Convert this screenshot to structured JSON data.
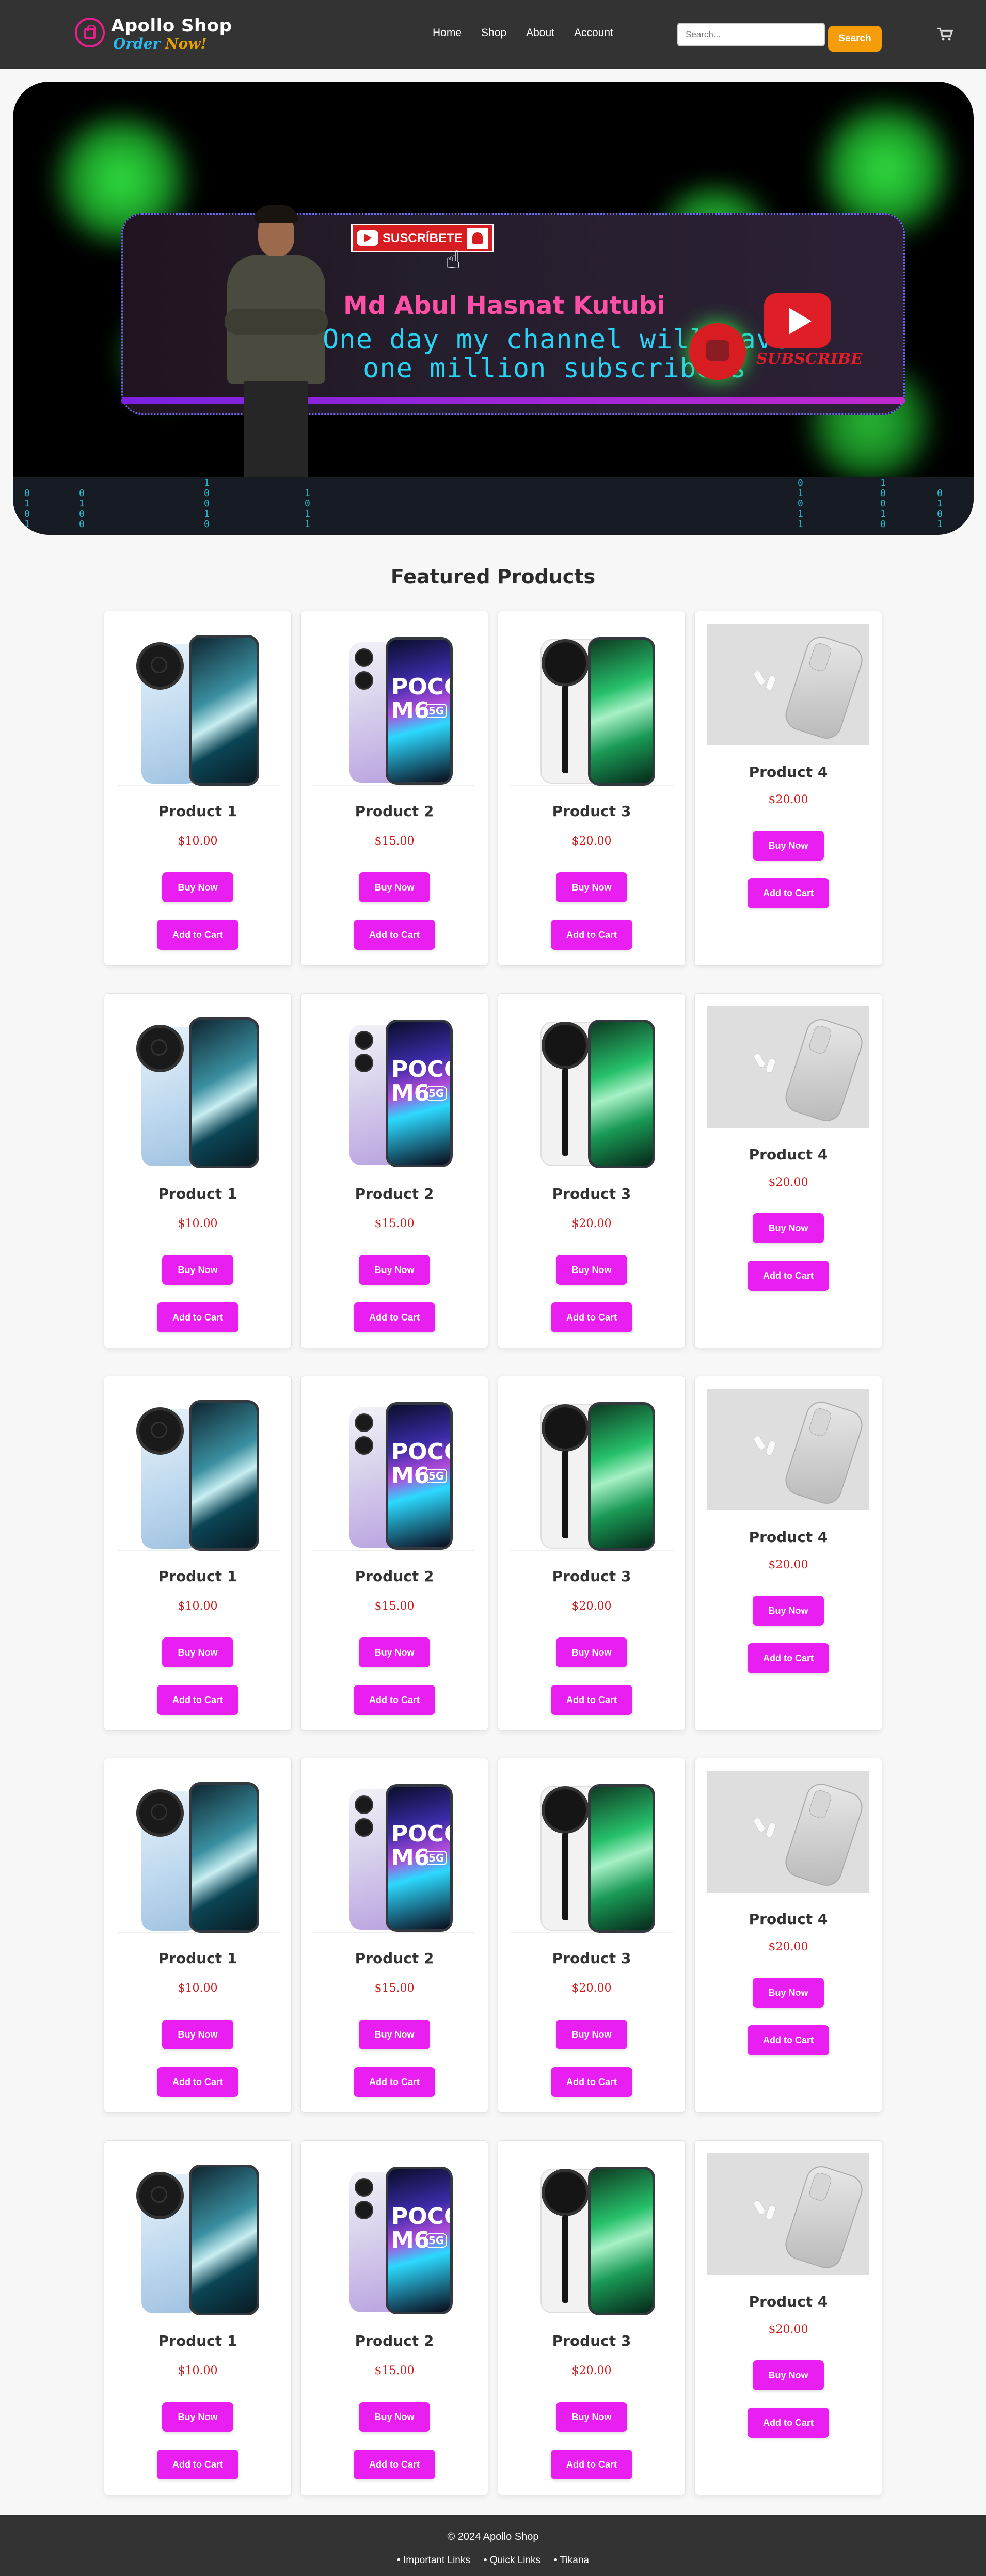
{
  "header": {
    "logo_name": "Apollo Shop",
    "logo_tag_a": "Order",
    "logo_tag_b": "Now!",
    "nav": [
      "Home",
      "Shop",
      "About",
      "Account"
    ],
    "search_placeholder": "Search...",
    "search_button": "Search",
    "cart_icon": "cart-icon"
  },
  "banner": {
    "subscribe_badge": "SUSCRÍBETE",
    "name": "Md Abul Hasnat Kutubi",
    "line1": "One day my channel will have",
    "line2": "one million subscribers",
    "subscribe_word": "SUBSCRIBE",
    "code_a": "0\n1\n0\n1",
    "code_b": "1\n0\n0\n1\n0",
    "code_c": "0\n1\n0\n0",
    "code_d": "1\n0\n1\n1",
    "code_e": "0\n1\n0\n1\n1"
  },
  "products_title": "Featured Products",
  "products": [
    {
      "name": "Product 1",
      "price": "$10.00",
      "buy": "Buy Now",
      "add": "Add to Cart",
      "image": "phone-blue"
    },
    {
      "name": "Product 2",
      "price": "$15.00",
      "buy": "Buy Now",
      "add": "Add to Cart",
      "image": "phone-poco"
    },
    {
      "name": "Product 3",
      "price": "$20.00",
      "buy": "Buy Now",
      "add": "Add to Cart",
      "image": "phone-green"
    },
    {
      "name": "Product 4",
      "price": "$20.00",
      "buy": "Buy Now",
      "add": "Add to Cart",
      "image": "iphone-airpods"
    }
  ],
  "poco": {
    "l1": "POCO",
    "l2": "M6",
    "l3": "5G"
  },
  "footer": {
    "copyright": "© 2024 Apollo Shop",
    "links": [
      "Important Links",
      "Quick Links",
      "Tikana"
    ]
  },
  "colors": {
    "header_bg": "#333333",
    "accent_button": "#e91ef0",
    "search_button": "#f59c0b",
    "price": "#d11a1a",
    "page_bg": "#f7f7f7"
  }
}
